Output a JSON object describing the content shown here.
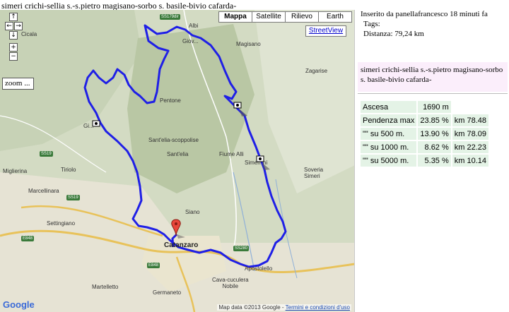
{
  "page": {
    "title": "simeri crichi-sellia s.-s.pietro magisano-sorbo s. basile-bivio cafarda-"
  },
  "map": {
    "types": [
      {
        "label": "Mappa",
        "active": true
      },
      {
        "label": "Satellite",
        "active": false
      },
      {
        "label": "Rilievo",
        "active": false
      },
      {
        "label": "Earth",
        "active": false
      }
    ],
    "streetview_label": "StreetView",
    "zoom_label": "zoom ...",
    "nav_icons": [
      "arrow-up-icon",
      "arrow-left-icon",
      "arrow-right-icon",
      "arrow-down-icon",
      "zoom-in-icon",
      "zoom-out-icon"
    ],
    "nav_glyphs": {
      "up": "↑",
      "left": "←",
      "right": "→",
      "down": "↓",
      "zoom_in": "+",
      "zoom_out": "−"
    },
    "route_color": "#1f1fe6",
    "background_color": "#d7dec8",
    "places": {
      "albi": "Albi",
      "magisano": "Magisano",
      "zagarise": "Zagarise",
      "cicala": "Cicala",
      "pentone": "Pentone",
      "gimigliano": "Gi...",
      "santelia_scoppolise": "Sant'elia-scoppolise",
      "santelia": "Sant'elia",
      "fiume_alli": "Fiume Alli",
      "simeri": "Simeri",
      "crichi": "hi",
      "soveria_simeri": "Soveria\nSimeri",
      "tiriolo": "Tiriolo",
      "miglierina": "Miglierina",
      "marcellinara": "Marcellinara",
      "settingiano": "Settingiano",
      "siano": "Siano",
      "catanzaro": "Catanzaro",
      "apostolello": "Apostolello",
      "cava_cuculera_nobile": "Cava-cuculera\nNobile",
      "martelletto": "Martelletto",
      "germaneto": "Germaneto",
      "giovino": "Giov..."
    },
    "roads": {
      "ss179": "SS179dir",
      "ss19a": "SS19",
      "ss19b": "SS19",
      "e848a": "E848",
      "e848b": "E848",
      "ss280": "SS280"
    },
    "attribution_text": "Map data ©2013 Google -",
    "attribution_link": "Termini e condizioni d'uso",
    "google_logo": "Google"
  },
  "info": {
    "inserted_by": "Inserito da panellafrancesco 18 minuti fa",
    "tags_label": "Tags:",
    "distance": "Distanza: 79,24 km",
    "route_name": "simeri crichi-sellia s.-s.pietro magisano-sorbo s. basile-bivio cafarda-"
  },
  "stats": {
    "rows": [
      {
        "label": "Ascesa",
        "value": "1690 m",
        "km": ""
      },
      {
        "label": "Pendenza max",
        "value": "23.85 %",
        "km": "km 78.48"
      },
      {
        "label": "\"\" su 500 m.",
        "value": "13.90 %",
        "km": "km 78.09"
      },
      {
        "label": "\"\" su 1000 m.",
        "value": "8.62 %",
        "km": "km 22.23"
      },
      {
        "label": "\"\" su 5000 m.",
        "value": "5.35 %",
        "km": "km 10.14"
      }
    ]
  }
}
